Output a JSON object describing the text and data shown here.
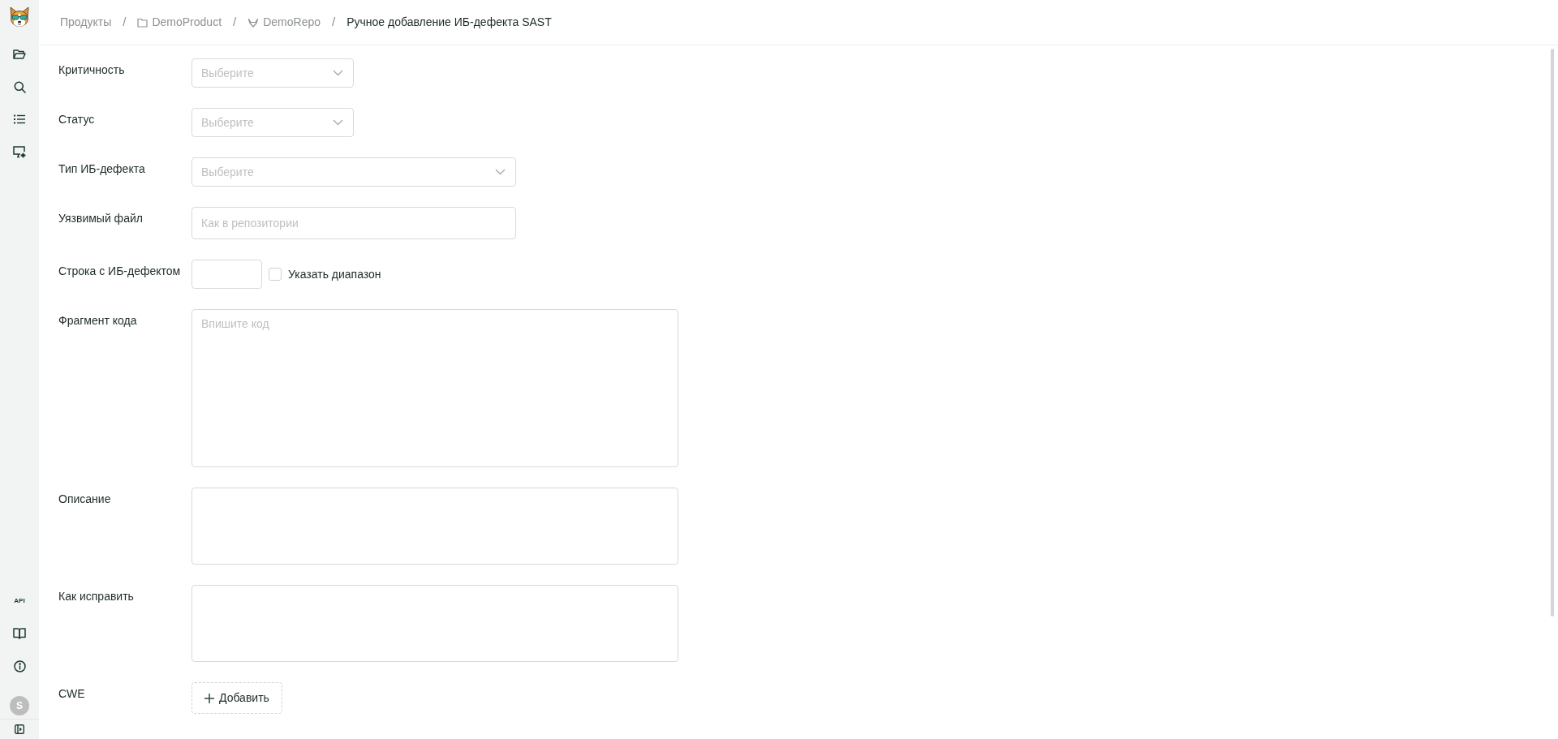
{
  "sidebar": {
    "api_label": "API",
    "avatar_initial": "S"
  },
  "breadcrumb": [
    {
      "kind": "link",
      "label": "Продукты"
    },
    {
      "kind": "separator",
      "label": "/"
    },
    {
      "kind": "folder",
      "label": "DemoProduct"
    },
    {
      "kind": "separator",
      "label": "/"
    },
    {
      "kind": "repo",
      "label": "DemoRepo"
    },
    {
      "kind": "separator",
      "label": "/"
    },
    {
      "kind": "current",
      "label": "Ручное добавление ИБ-дефекта SAST"
    }
  ],
  "form": {
    "fields": [
      {
        "kind": "select",
        "label": "Критичность",
        "placeholder": "Выберите"
      },
      {
        "kind": "select",
        "label": "Статус",
        "placeholder": "Выберите"
      },
      {
        "kind": "select",
        "label": "Тип ИБ-дефекта",
        "placeholder": "Выберите"
      },
      {
        "kind": "text",
        "label": "Уязвимый файл",
        "placeholder": "Как в репозитории"
      },
      {
        "kind": "line",
        "label": "Строка с ИБ-дефектом",
        "checkbox": {
          "label": "Указать диапазон",
          "checked": false
        }
      },
      {
        "kind": "textarea",
        "label": "Фрагмент кода",
        "placeholder": "Впишите код"
      },
      {
        "kind": "textarea",
        "label": "Описание"
      },
      {
        "kind": "textarea",
        "label": "Как исправить"
      },
      {
        "kind": "add",
        "label": "CWE",
        "button": "Добавить"
      }
    ]
  }
}
